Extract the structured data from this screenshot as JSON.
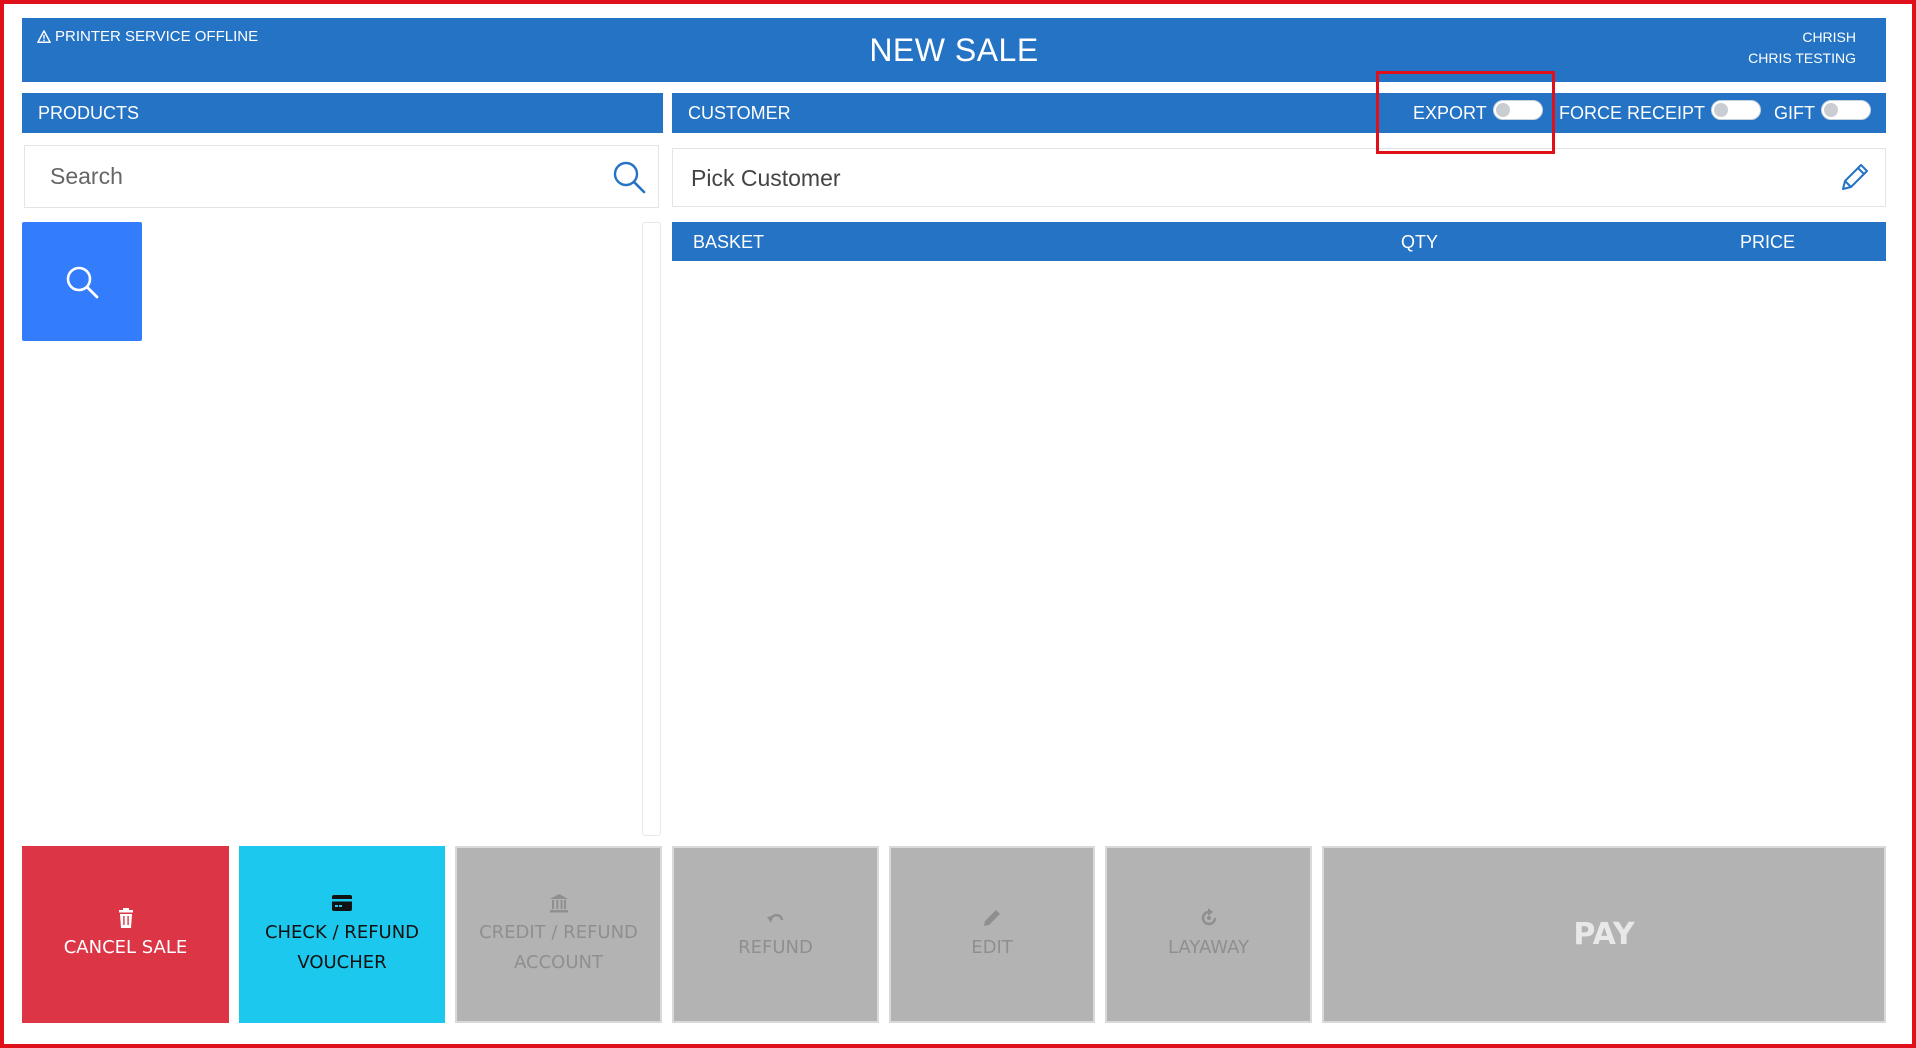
{
  "header": {
    "printer_status": "PRINTER SERVICE OFFLINE",
    "title": "NEW SALE",
    "user_name": "CHRISH",
    "store_name": "CHRIS TESTING"
  },
  "products": {
    "header_label": "PRODUCTS",
    "search_placeholder": "Search"
  },
  "customer": {
    "header_label": "CUSTOMER",
    "pick_label": "Pick Customer",
    "toggles": [
      {
        "label": "EXPORT",
        "on": false
      },
      {
        "label": "FORCE RECEIPT",
        "on": false
      },
      {
        "label": "GIFT",
        "on": false
      }
    ]
  },
  "basket": {
    "columns": [
      "BASKET",
      "QTY",
      "PRICE"
    ]
  },
  "actions": {
    "cancel_sale": "CANCEL SALE",
    "check_voucher_line1": "CHECK / REFUND",
    "check_voucher_line2": "VOUCHER",
    "credit_line1": "CREDIT / REFUND",
    "credit_line2": "ACCOUNT",
    "refund": "REFUND",
    "edit": "EDIT",
    "layaway": "LAYAWAY",
    "pay": "PAY"
  },
  "colors": {
    "primary": "#2473c4",
    "danger": "#dc3545",
    "info": "#1cc8ee",
    "tile": "#337cfc",
    "disabled": "#b3b3b3"
  }
}
